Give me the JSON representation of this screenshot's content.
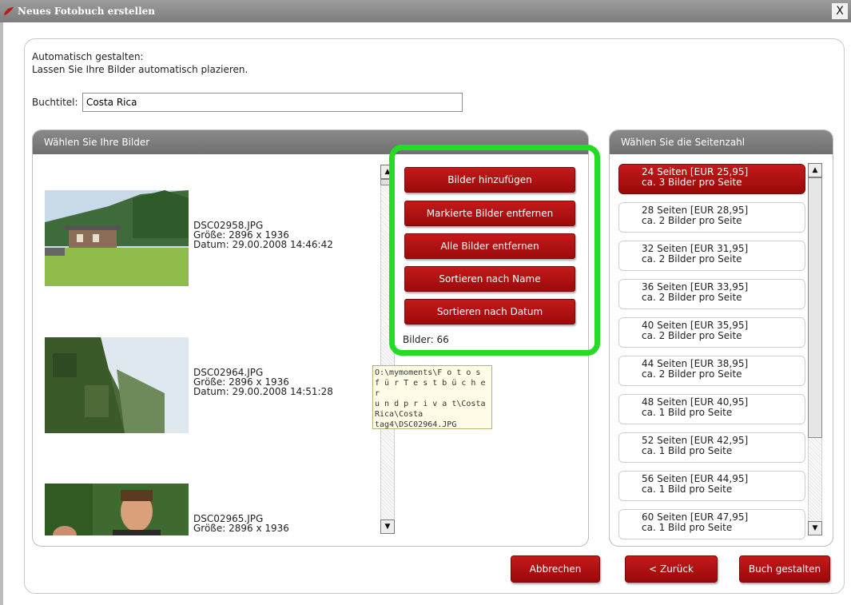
{
  "window": {
    "title": "Neues Fotobuch erstellen",
    "close_label": "X"
  },
  "intro": {
    "line1": "Automatisch gestalten:",
    "line2": "Lassen Sie Ihre Bilder automatisch plazieren."
  },
  "book_title": {
    "label": "Buchtitel:",
    "value": "Costa Rica"
  },
  "images_panel": {
    "header": "Wählen Sie Ihre Bilder",
    "items": [
      {
        "name": "DSC02958.JPG",
        "size": "Größe: 2896 x 1936",
        "date": "Datum: 29.00.2008 14:46:42"
      },
      {
        "name": "DSC02964.JPG",
        "size": "Größe: 2896 x 1936",
        "date": "Datum: 29.00.2008 14:51:28"
      },
      {
        "name": "DSC02965.JPG",
        "size": "Größe: 2896 x 1936",
        "date": ""
      }
    ]
  },
  "actions": {
    "add": "Bilder hinzufügen",
    "remove_marked": "Markierte Bilder entfernen",
    "remove_all": "Alle Bilder entfernen",
    "sort_name": "Sortieren nach Name",
    "sort_date": "Sortieren nach Datum",
    "count": "Bilder: 66"
  },
  "tooltip": {
    "line1": "O:\\mymoments\\F o t o s",
    "line2": " f ü r  T e s t b ü c h e r",
    "line3": "u n d  p r i v a t\\Costa",
    "line4": "Rica\\Costa",
    "line5": "tag4\\DSC02964.JPG"
  },
  "pages_panel": {
    "header": "Wählen Sie die Seitenzahl",
    "options": [
      {
        "pages": "24 Seiten [EUR 25,95]",
        "per_page": "ca. 3 Bilder pro Seite"
      },
      {
        "pages": "28 Seiten [EUR 28,95]",
        "per_page": "ca. 2 Bilder pro Seite"
      },
      {
        "pages": "32 Seiten [EUR 31,95]",
        "per_page": "ca. 2 Bilder pro Seite"
      },
      {
        "pages": "36 Seiten [EUR 33,95]",
        "per_page": "ca. 2 Bilder pro Seite"
      },
      {
        "pages": "40 Seiten [EUR 35,95]",
        "per_page": "ca. 2 Bilder pro Seite"
      },
      {
        "pages": "44 Seiten [EUR 38,95]",
        "per_page": "ca. 2 Bilder pro Seite"
      },
      {
        "pages": "48 Seiten [EUR 40,95]",
        "per_page": "ca. 1 Bild pro Seite"
      },
      {
        "pages": "52 Seiten [EUR 42,95]",
        "per_page": "ca. 1 Bild pro Seite"
      },
      {
        "pages": "56 Seiten [EUR 44,95]",
        "per_page": "ca. 1 Bild pro Seite"
      },
      {
        "pages": "60 Seiten [EUR 47,95]",
        "per_page": "ca. 1 Bild pro Seite"
      }
    ],
    "selected_index": 0
  },
  "footer": {
    "cancel": "Abbrechen",
    "back": "< Zurück",
    "create": "Buch gestalten"
  },
  "colors": {
    "accent_red": "#b01010",
    "highlight_green": "#22dd22",
    "panel_header": "#7d7d7d"
  }
}
